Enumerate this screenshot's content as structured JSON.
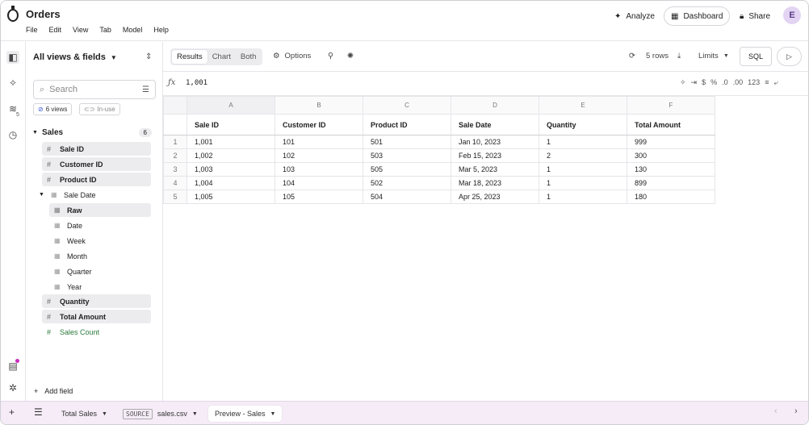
{
  "app": {
    "title": "Orders",
    "avatar_initial": "E"
  },
  "menu": [
    "File",
    "Edit",
    "View",
    "Tab",
    "Model",
    "Help"
  ],
  "header_actions": {
    "analyze": "Analyze",
    "dashboard": "Dashboard",
    "share": "Share"
  },
  "rail_badge": "5",
  "side": {
    "views_title": "All views & fields",
    "search_placeholder": "Search",
    "chip_views": "6 views",
    "chip_inuse": "In-use",
    "group_name": "Sales",
    "group_count": "6",
    "fields": [
      "Sale ID",
      "Customer ID",
      "Product ID"
    ],
    "date_field": "Sale Date",
    "date_parts": [
      "Raw",
      "Date",
      "Week",
      "Month",
      "Quarter",
      "Year"
    ],
    "fields_after": [
      "Quantity",
      "Total Amount"
    ],
    "measure": "Sales Count",
    "add_field": "Add field"
  },
  "toolbar": {
    "seg": [
      "Results",
      "Chart",
      "Both"
    ],
    "options": "Options",
    "rows": "5 rows",
    "limits": "Limits",
    "sql": "SQL"
  },
  "formula": {
    "fx": "ƒx",
    "value": "1,001"
  },
  "grid": {
    "letters": [
      "A",
      "B",
      "C",
      "D",
      "E",
      "F"
    ],
    "columns": [
      "Sale ID",
      "Customer ID",
      "Product ID",
      "Sale Date",
      "Quantity",
      "Total Amount"
    ],
    "rows": [
      [
        "1",
        "1,001",
        "101",
        "501",
        "Jan 10, 2023",
        "1",
        "999"
      ],
      [
        "2",
        "1,002",
        "102",
        "503",
        "Feb 15, 2023",
        "2",
        "300"
      ],
      [
        "3",
        "1,003",
        "103",
        "505",
        "Mar 5, 2023",
        "1",
        "130"
      ],
      [
        "4",
        "1,004",
        "104",
        "502",
        "Mar 18, 2023",
        "1",
        "899"
      ],
      [
        "5",
        "1,005",
        "105",
        "504",
        "Apr 25, 2023",
        "1",
        "180"
      ]
    ]
  },
  "bottom": {
    "tab1": "Total Sales",
    "source_chip": "SOURCE",
    "tab2": "sales.csv",
    "tab3": "Preview - Sales"
  },
  "colors": {
    "accent": "#cc2bbd",
    "measure_green": "#2b7a3b",
    "bottom_bar": "#f5ecf7"
  }
}
